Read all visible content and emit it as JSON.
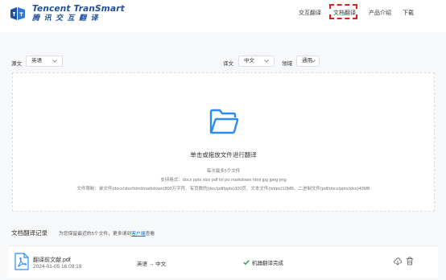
{
  "header": {
    "logo_en": "Tencent TranSmart",
    "logo_cn": "腾讯交互翻译",
    "nav": [
      {
        "label": "交互翻译"
      },
      {
        "label": "文档翻译"
      },
      {
        "label": "产品介绍"
      },
      {
        "label": "下载"
      }
    ],
    "active_tab": "文档翻译",
    "brand_color": "#1f4f9c",
    "highlight_color": "#e02020"
  },
  "language_bar": {
    "source_label": "源文",
    "source_value": "英语",
    "target_label": "译文",
    "target_value": "中文",
    "domain_label": "领域",
    "domain_value": "通用"
  },
  "upload": {
    "title": "单击或拖放文件进行翻译",
    "max_files": "每次最多5个文件",
    "formats": "支持格式：docx pptx xlsx pdf txt po markdown html jpg jpeg png",
    "limits": "文件限制：单文件(docx/xlsx/html/markdown)800万字符、有页数的(doc/pdf/pptx)300页、文本文件(txt/po)10MB、二进制文件(pdf/docx/pptx/xlsx)40MB",
    "icon": "folder-icon",
    "icon_color": "#2a8cf0"
  },
  "records": {
    "title": "文档翻译记录",
    "note_prefix": "为您保留最近的5个文件，更多请到",
    "note_link": "客户端",
    "note_suffix": "查看",
    "items": [
      {
        "file_name": "翻译前文献.pdf",
        "date": "2024-01-05 16:09:19",
        "lang_pair": "英语 → 中文",
        "status": "机器翻译完成",
        "status_color": "#1fa83a"
      }
    ]
  }
}
